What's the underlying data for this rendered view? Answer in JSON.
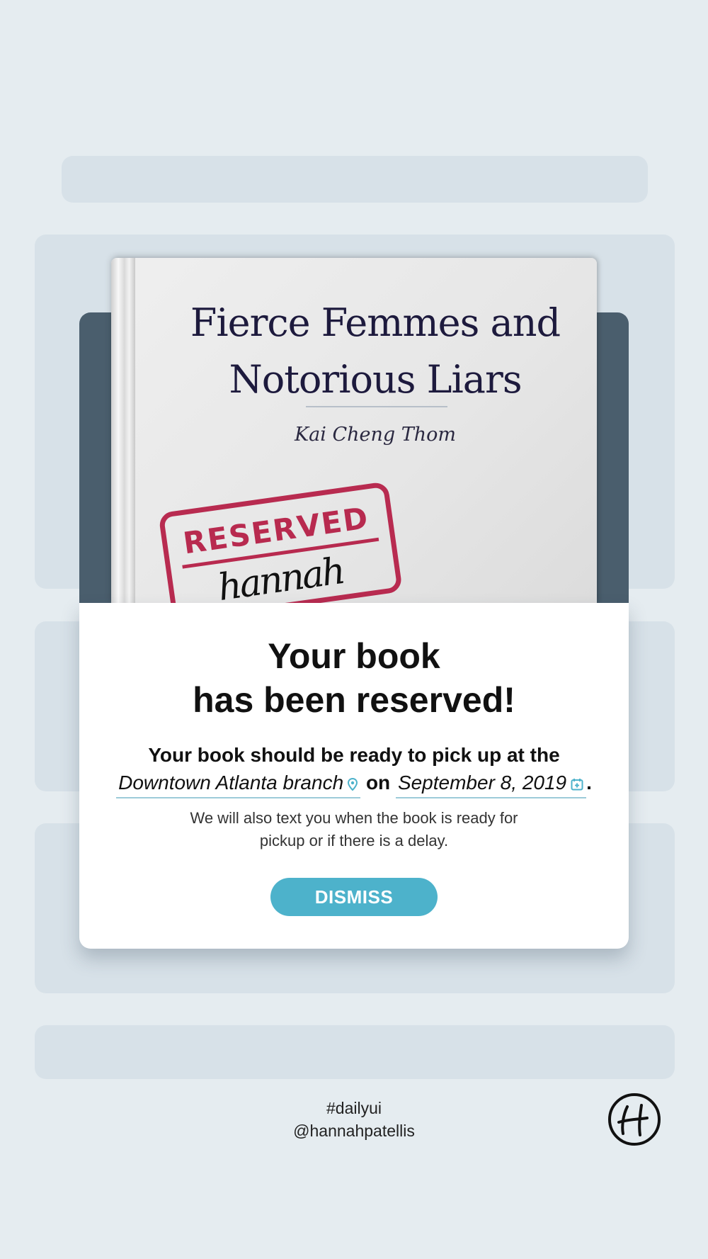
{
  "book": {
    "title_line1": "Fierce Femmes and",
    "title_line2": "Notorious Liars",
    "author": "Kai Cheng Thom",
    "stamp_text": "RESERVED",
    "stamp_signature": "hannah"
  },
  "modal": {
    "headline_line1": "Your book",
    "headline_line2": "has been reserved!",
    "body_text": "Your book should be ready to pick up at the",
    "branch_link": "Downtown Atlanta branch",
    "connector": "on",
    "date_link": "September 8, 2019",
    "period": ".",
    "note_line1": "We will also text you when the book is ready for",
    "note_line2": "pickup or if there is a delay.",
    "dismiss_label": "DISMISS"
  },
  "footer": {
    "hashtag": "#dailyui",
    "handle": "@hannahpatellis"
  },
  "colors": {
    "background": "#e5ecf0",
    "skeleton": "#d7e1e8",
    "modal_header": "#4a5e6d",
    "accent": "#4db2cb",
    "stamp": "#b3163f"
  }
}
